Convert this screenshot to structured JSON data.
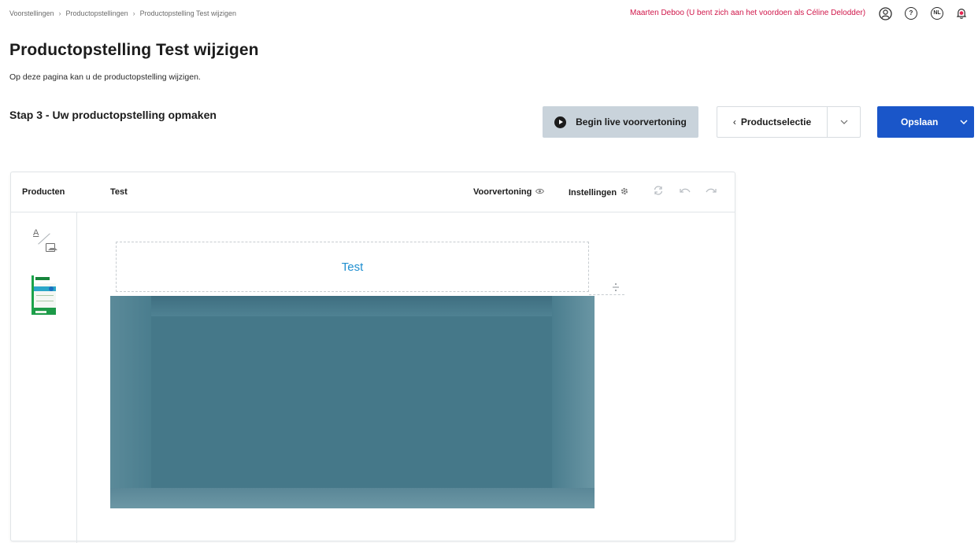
{
  "breadcrumb": {
    "items": [
      "Voorstellingen",
      "Productopstellingen",
      "Productopstelling Test wijzigen"
    ],
    "separator": "›"
  },
  "header": {
    "impersonation": "Maarten Deboo (U bent zich aan het voordoen als Céline Delodder)",
    "lang": "NL",
    "help": "?"
  },
  "page": {
    "title": "Productopstelling Test wijzigen",
    "subtitle": "Op deze pagina kan u de productopstelling wijzigen.",
    "step_title": "Stap 3 - Uw productopstelling opmaken"
  },
  "toolbar": {
    "live_preview_label": "Begin live voorvertoning",
    "prev_label": "Productselectie",
    "save_label": "Opslaan"
  },
  "editor": {
    "products_label": "Producten",
    "name": "Test",
    "preview_label": "Voorvertoning",
    "settings_label": "Instellingen",
    "header_text": "Test"
  },
  "colors": {
    "accent": "#1a56c9",
    "impersonation": "#d0174a",
    "header_text": "#1f8fd0",
    "shelf": "#4a7d8e"
  }
}
